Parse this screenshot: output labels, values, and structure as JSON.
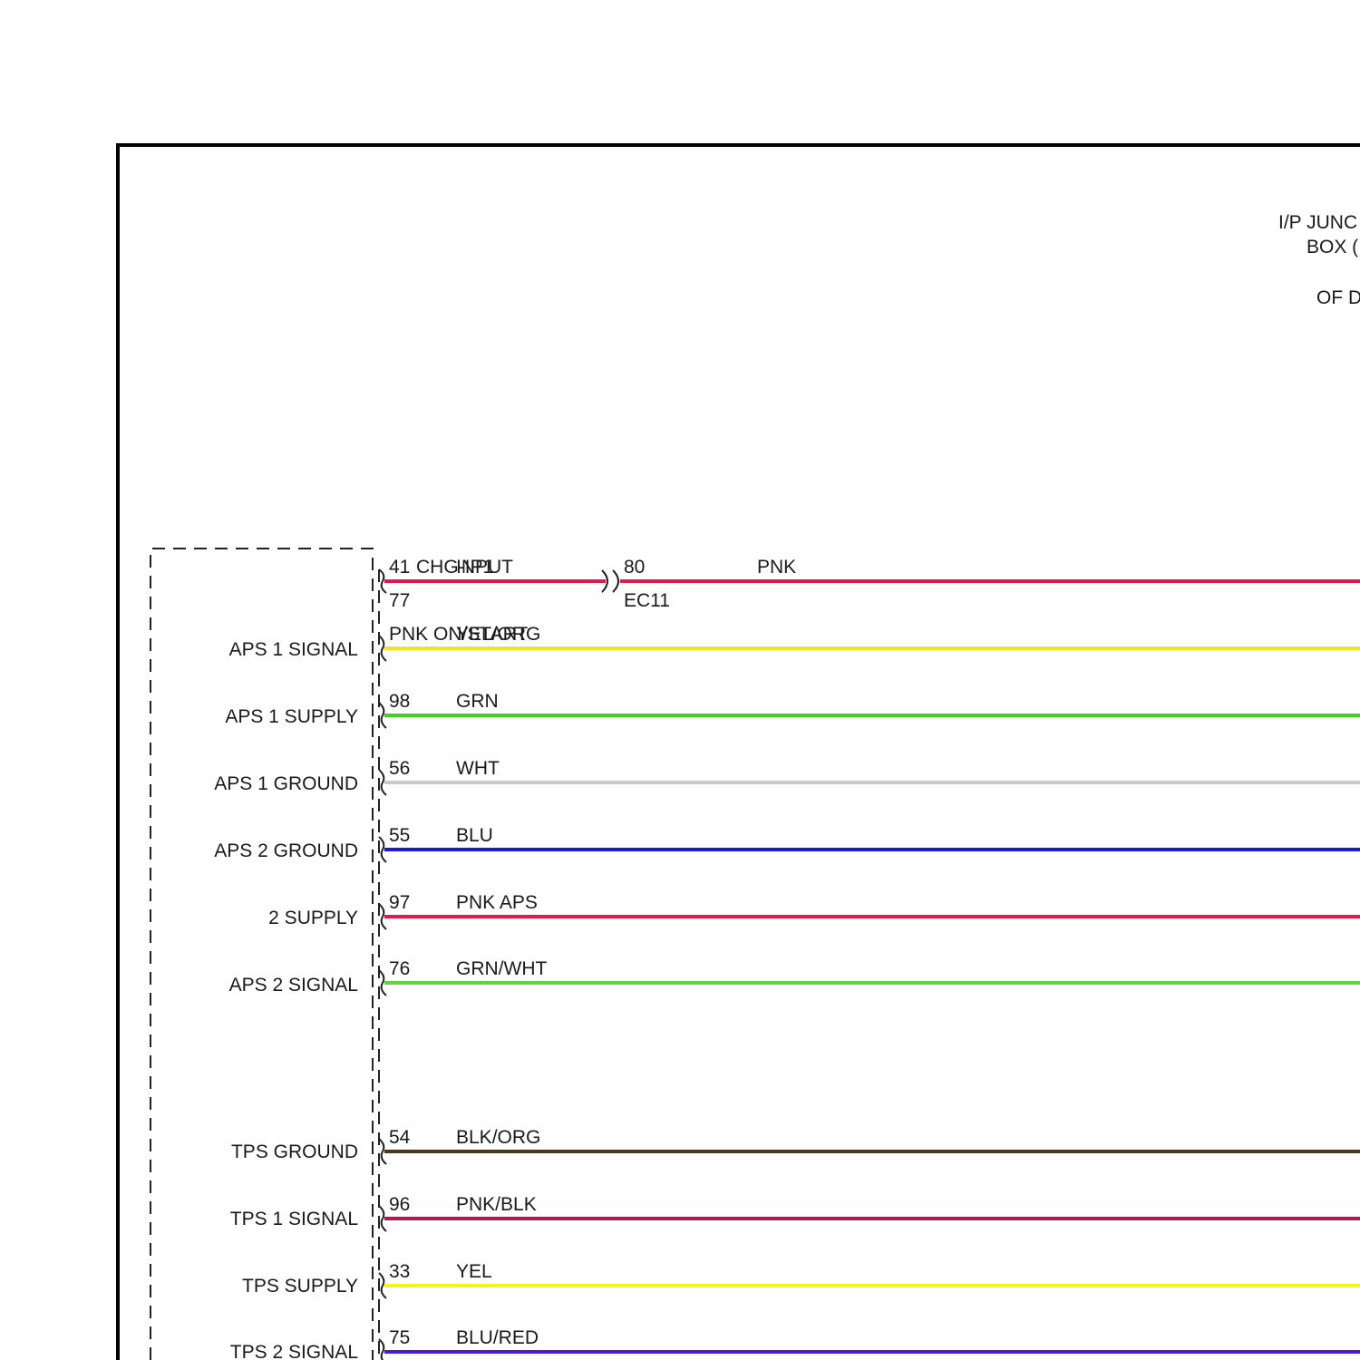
{
  "junction_box_label": [
    "I/P JUNC",
    "BOX (",
    "OF D"
  ],
  "module_signals": [
    "APS 1 SIGNAL",
    "APS 1 SUPPLY",
    "APS 1 GROUND",
    "APS 2 GROUND",
    "2 SUPPLY",
    "APS 2 SIGNAL",
    "TPS GROUND",
    "TPS 1 SIGNAL",
    "TPS SUPPLY",
    "TPS 2 SIGNAL"
  ],
  "top_wire": {
    "pin": "41",
    "name_a": "CHG-IP1",
    "name_b": "INPUT",
    "pin_below": "77",
    "connector_pin": "80",
    "connector_name": "EC11",
    "color_label": "PNK",
    "color": "#e0194f"
  },
  "overlap_label": {
    "a": "PNK ON/START",
    "b": "YEL/ORG"
  },
  "wires": [
    {
      "pin": "",
      "label": "",
      "color": "#f2e516"
    },
    {
      "pin": "98",
      "label": "GRN",
      "color": "#3fd41e"
    },
    {
      "pin": "56",
      "label": "WHT",
      "color": "#c9c9c9"
    },
    {
      "pin": "55",
      "label": "BLU",
      "color": "#1a1ad4"
    },
    {
      "pin": "97",
      "label": "PNK APS",
      "color": "#e0194f"
    },
    {
      "pin": "76",
      "label": "GRN/WHT",
      "color": "#5fd63a"
    },
    {
      "pin": "54",
      "label": "BLK/ORG",
      "color": "#4a3a1a"
    },
    {
      "pin": "96",
      "label": "PNK/BLK",
      "color": "#b3194a"
    },
    {
      "pin": "33",
      "label": "YEL",
      "color": "#f5f51a"
    },
    {
      "pin": "75",
      "label": "BLU/RED",
      "color": "#4a1ad4"
    }
  ]
}
